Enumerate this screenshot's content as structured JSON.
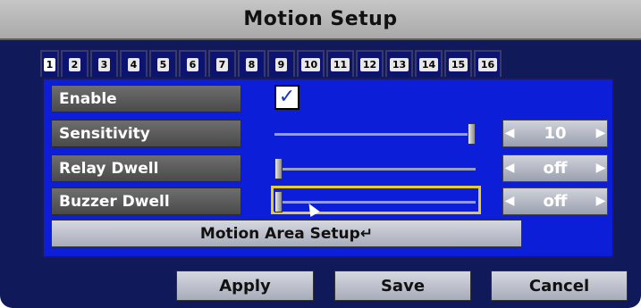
{
  "window": {
    "title": "Motion Setup"
  },
  "tabs": [
    {
      "label": "1",
      "active": true
    },
    {
      "label": "2"
    },
    {
      "label": "3"
    },
    {
      "label": "4"
    },
    {
      "label": "5"
    },
    {
      "label": "6"
    },
    {
      "label": "7"
    },
    {
      "label": "8"
    },
    {
      "label": "9"
    },
    {
      "label": "10"
    },
    {
      "label": "11"
    },
    {
      "label": "12"
    },
    {
      "label": "13"
    },
    {
      "label": "14"
    },
    {
      "label": "15"
    },
    {
      "label": "16"
    }
  ],
  "settings": {
    "enable": {
      "label": "Enable",
      "checked": true,
      "check_glyph": "✓"
    },
    "sensitivity": {
      "label": "Sensitivity",
      "value": "10",
      "slider_level": 1.0
    },
    "relay_dwell": {
      "label": "Relay Dwell",
      "value": "off",
      "slider_level": 0.0
    },
    "buzzer_dwell": {
      "label": "Buzzer Dwell",
      "value": "off",
      "slider_level": 0.0
    }
  },
  "area_button": {
    "label": "Motion Area Setup↵"
  },
  "buttons": {
    "apply": "Apply",
    "save": "Save",
    "cancel": "Cancel"
  },
  "icons": {
    "left_arrow": "◀",
    "right_arrow": "▶"
  },
  "colors": {
    "panel": "#0c1ed8",
    "background": "#101a5a",
    "focus": "#e8cc2a"
  }
}
